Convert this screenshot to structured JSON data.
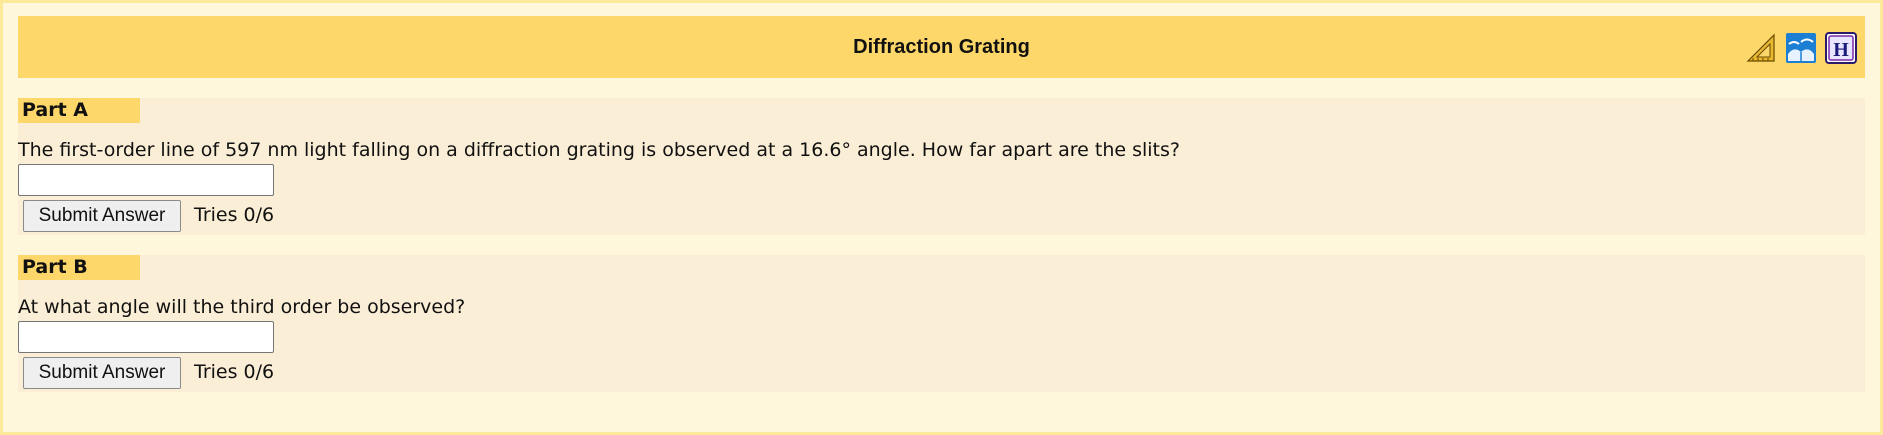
{
  "header": {
    "title": "Diffraction Grating",
    "icons": [
      "triangle-ruler-icon",
      "wave-book-icon",
      "hint-h-icon"
    ]
  },
  "parts": [
    {
      "label": "Part A",
      "question": "The first-order line of 597 nm light falling on a diffraction grating is observed at a 16.6° angle. How far apart are the slits?",
      "input_value": "",
      "submit_label": "Submit Answer",
      "tries": "Tries 0/6"
    },
    {
      "label": "Part B",
      "question": "At what angle will the third order be observed?",
      "input_value": "",
      "submit_label": "Submit Answer",
      "tries": "Tries 0/6"
    }
  ],
  "colors": {
    "header_bg": "#fdd76a",
    "page_bg": "#fef7dc",
    "part_bg": "#fbeed6"
  }
}
